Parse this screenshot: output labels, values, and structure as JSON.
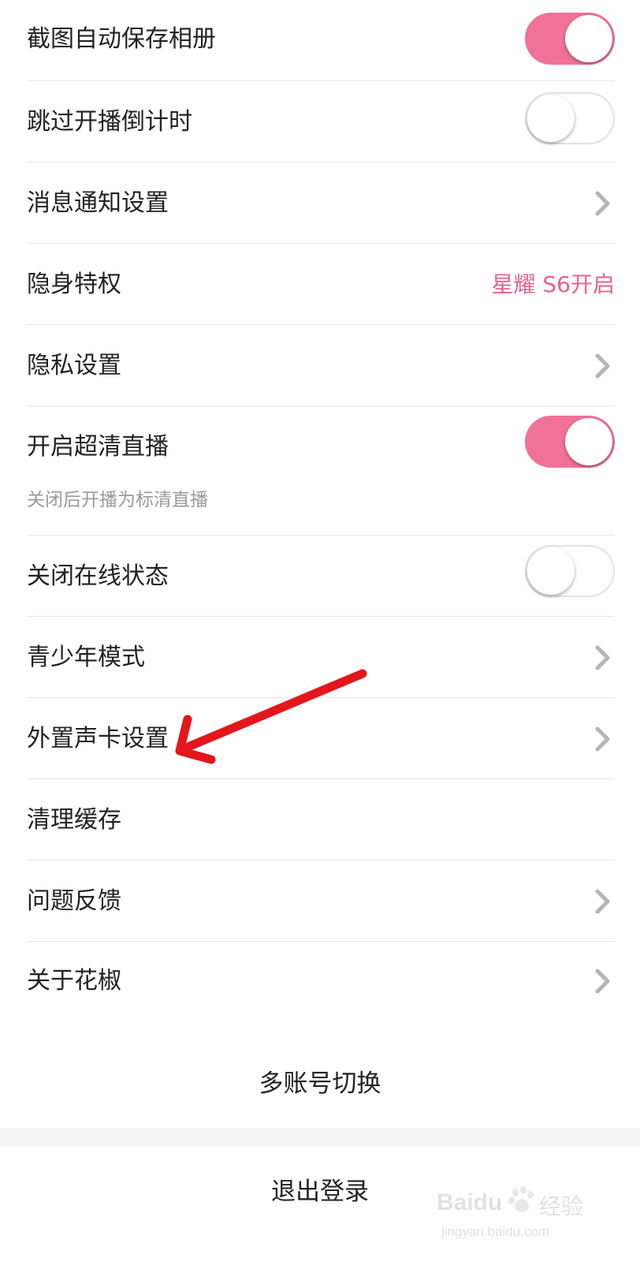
{
  "settings": {
    "items": [
      {
        "label": "截图自动保存相册",
        "control": "toggle",
        "state": "on"
      },
      {
        "label": "跳过开播倒计时",
        "control": "toggle",
        "state": "off"
      },
      {
        "label": "消息通知设置",
        "control": "chevron"
      },
      {
        "label": "隐身特权",
        "control": "status",
        "status": "星耀 S6开启"
      },
      {
        "label": "隐私设置",
        "control": "chevron"
      },
      {
        "label": "开启超清直播",
        "control": "toggle",
        "state": "on",
        "sublabel": "关闭后开播为标清直播"
      },
      {
        "label": "关闭在线状态",
        "control": "toggle",
        "state": "off"
      },
      {
        "label": "青少年模式",
        "control": "chevron"
      },
      {
        "label": "外置声卡设置",
        "control": "chevron"
      },
      {
        "label": "清理缓存",
        "control": "none"
      },
      {
        "label": "问题反馈",
        "control": "chevron"
      },
      {
        "label": "关于花椒",
        "control": "chevron"
      }
    ]
  },
  "actions": {
    "switch_account": "多账号切换",
    "logout": "退出登录"
  },
  "watermark": {
    "brand": "Baidu",
    "suffix": "经验",
    "url": "jingyan.baidu.com"
  },
  "colors": {
    "accent": "#f0729b",
    "status_text": "#e8618f",
    "annotation_arrow": "#e3161b",
    "separator": "#e6e6e6",
    "background": "#f4f4f4"
  },
  "icons": {
    "chevron": "chevron-right-icon",
    "annotation": "red-arrow-annotation"
  }
}
